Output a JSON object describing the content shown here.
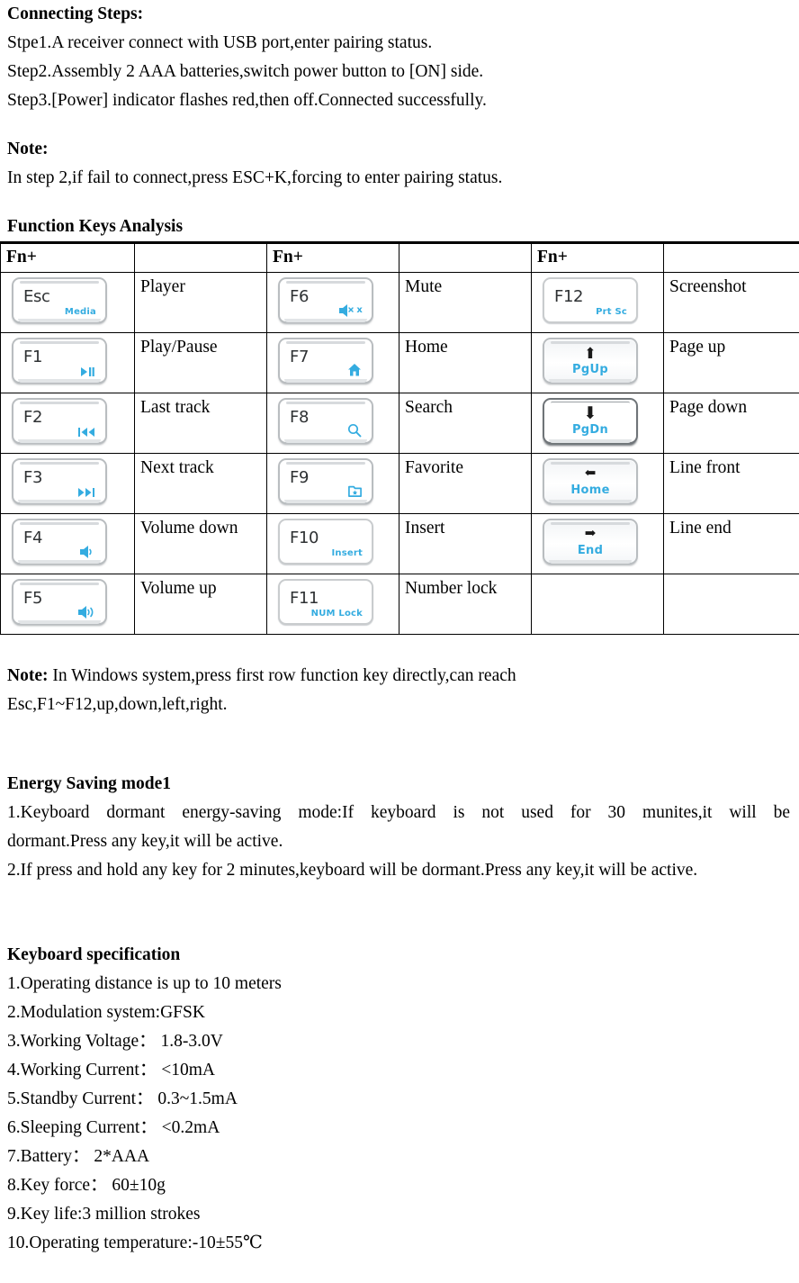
{
  "connecting": {
    "heading": "Connecting Steps:",
    "steps": [
      "Stpe1.A receiver connect with USB port,enter pairing status.",
      "Step2.Assembly 2 AAA batteries,switch power button to [ON] side.",
      "Step3.[Power] indicator flashes red,then off.Connected successfully."
    ]
  },
  "note1": {
    "heading": "Note:",
    "text": "In step 2,if fail to connect,press ESC+K,forcing to enter pairing status."
  },
  "function_keys": {
    "heading": "Function Keys Analysis",
    "headers": [
      "Fn+",
      "",
      "Fn+",
      "",
      "Fn+",
      ""
    ],
    "rows": [
      {
        "key1": {
          "main": "Esc",
          "sub": "Media",
          "icon": "text-sub"
        },
        "label1": "Player",
        "key2": {
          "main": "F6",
          "sub": "x",
          "icon": "mute-icon"
        },
        "label2": "Mute",
        "key3": {
          "main": "F12",
          "sub": "Prt Sc",
          "icon": "text-sub",
          "style": "flat"
        },
        "label3": "Screenshot"
      },
      {
        "key1": {
          "main": "F1",
          "sub": "",
          "icon": "play-pause-icon"
        },
        "label1": "Play/Pause",
        "key2": {
          "main": "F7",
          "sub": "",
          "icon": "home-house-icon"
        },
        "label2": "Home",
        "key3": {
          "main": "",
          "sub": "PgUp",
          "icon": "arrow-up-icon",
          "style": "arrow shade"
        },
        "label3": "Page up"
      },
      {
        "key1": {
          "main": "F2",
          "sub": "",
          "icon": "previous-track-icon"
        },
        "label1": "Last track",
        "key2": {
          "main": "F8",
          "sub": "",
          "icon": "search-icon"
        },
        "label2": "Search",
        "key3": {
          "main": "",
          "sub": "PgDn",
          "icon": "arrow-down-icon",
          "style": "arrow pressed"
        },
        "label3": "Page down"
      },
      {
        "key1": {
          "main": "F3",
          "sub": "",
          "icon": "next-track-icon"
        },
        "label1": "Next track",
        "key2": {
          "main": "F9",
          "sub": "",
          "icon": "favorite-folder-icon"
        },
        "label2": "Favorite",
        "key3": {
          "main": "",
          "sub": "Home",
          "icon": "arrow-left-icon",
          "style": "arrow shade"
        },
        "label3": "Line front"
      },
      {
        "key1": {
          "main": "F4",
          "sub": "",
          "icon": "volume-down-icon"
        },
        "label1": "Volume down",
        "key2": {
          "main": "F10",
          "sub": "Insert",
          "icon": "text-sub",
          "style": "flat"
        },
        "label2": "Insert",
        "key3": {
          "main": "",
          "sub": "End",
          "icon": "arrow-right-icon",
          "style": "arrow shade"
        },
        "label3": "Line end"
      },
      {
        "key1": {
          "main": "F5",
          "sub": "",
          "icon": "volume-up-icon"
        },
        "label1": "Volume up",
        "key2": {
          "main": "F11",
          "sub": "NUM Lock",
          "icon": "text-sub",
          "style": "flat"
        },
        "label2": "Number lock",
        "key3": null,
        "label3": ""
      }
    ]
  },
  "note2": {
    "heading": "Note:",
    "text": " In Windows system,press first row function key directly,can reach",
    "line2": "Esc,F1~F12,up,down,left,right."
  },
  "energy": {
    "heading": "Energy Saving mode1",
    "items": [
      "1.Keyboard dormant energy-saving mode:If keyboard is not used for 30 munites,it will be",
      "dormant.Press any key,it will be active.",
      "2.If press and hold any key for 2 minutes,keyboard will be dormant.Press any key,it will be active."
    ]
  },
  "spec": {
    "heading": "Keyboard specification",
    "items": [
      "1.Operating distance is up to 10 meters",
      "2.Modulation system:GFSK",
      "3.Working Voltage： 1.8-3.0V",
      "4.Working Current： <10mA",
      "5.Standby Current： 0.3~1.5mA",
      "6.Sleeping Current： <0.2mA",
      "7.Battery： 2*AAA",
      "8.Key force： 60±10g",
      "9.Key life:3 million strokes",
      "10.Operating temperature:-10±55℃"
    ]
  },
  "colors": {
    "key_sub_blue": "#34ace0",
    "key_border_grey": "#b9bdc0",
    "text_black": "#000000"
  }
}
